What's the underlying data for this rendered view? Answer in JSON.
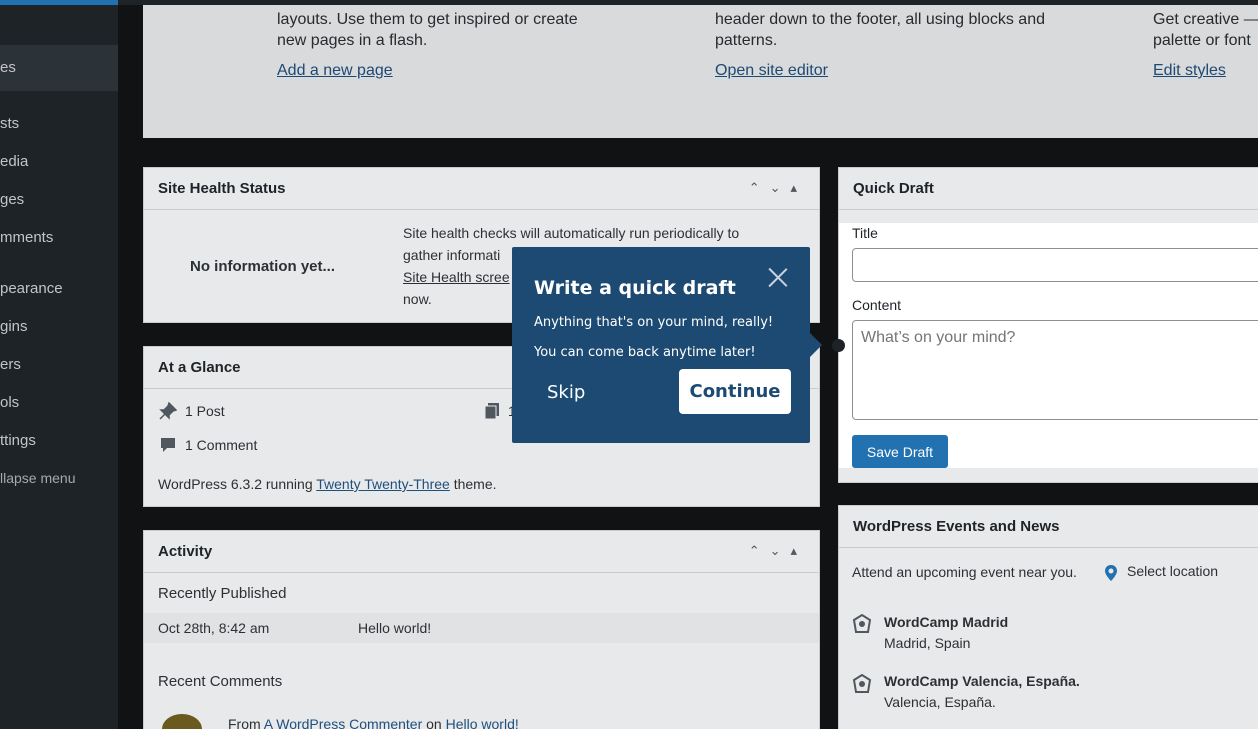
{
  "sidebar": {
    "items": [
      {
        "label": "es"
      },
      {
        "label": "sts"
      },
      {
        "label": "edia"
      },
      {
        "label": "ges"
      },
      {
        "label": "mments"
      },
      {
        "label": "pearance"
      },
      {
        "label": "gins"
      },
      {
        "label": "ers"
      },
      {
        "label": "ols"
      },
      {
        "label": "ttings"
      }
    ],
    "collapse_label": "llapse menu"
  },
  "welcome": {
    "col1_text": "layouts. Use them to get inspired or create new pages in a flash.",
    "col1_link": "Add a new page",
    "col2_text": "header down to the footer, all using blocks and patterns.",
    "col2_link": "Open site editor",
    "col3_text": "Get creative — palette or font",
    "col3_link": "Edit styles"
  },
  "site_health": {
    "title": "Site Health Status",
    "no_info": "No information yet...",
    "desc_1": "Site health checks will automatically run periodically to",
    "desc_2": "gather informati",
    "link": "Site Health scree",
    "desc_3": "now."
  },
  "at_a_glance": {
    "title": "At a Glance",
    "posts": "1 Post",
    "comments": "1 Comment",
    "pages_partial": "1",
    "footer_prefix": "WordPress 6.3.2 running ",
    "theme_link": "Twenty Twenty-Three",
    "footer_suffix": " theme."
  },
  "activity": {
    "title": "Activity",
    "recently_published": "Recently Published",
    "date": "Oct 28th, 8:42 am",
    "post_link": "Hello world!",
    "recent_comments": "Recent Comments",
    "comment_from": "From ",
    "commenter": "A WordPress Commenter",
    "on": " on ",
    "comment_post": "Hello world!"
  },
  "quick_draft": {
    "title": "Quick Draft",
    "title_label": "Title",
    "title_value": "",
    "content_label": "Content",
    "content_placeholder": "What’s on your mind?",
    "save_label": "Save Draft"
  },
  "tour": {
    "heading": "Write a quick draft",
    "line1": "Anything that's on your mind, really!",
    "line2": "You can come back anytime later!",
    "skip": "Skip",
    "continue": "Continue"
  },
  "events": {
    "title": "WordPress Events and News",
    "attend": "Attend an upcoming event near you.",
    "select_location": "Select location",
    "items": [
      {
        "name": "WordCamp Madrid",
        "place": "Madrid, Spain"
      },
      {
        "name": "WordCamp Valencia, España.",
        "place": "Valencia, España."
      }
    ]
  },
  "colors": {
    "tour_bg": "#1d4a72",
    "button_primary": "#2271b1",
    "sidebar_bg": "#1d2327"
  }
}
